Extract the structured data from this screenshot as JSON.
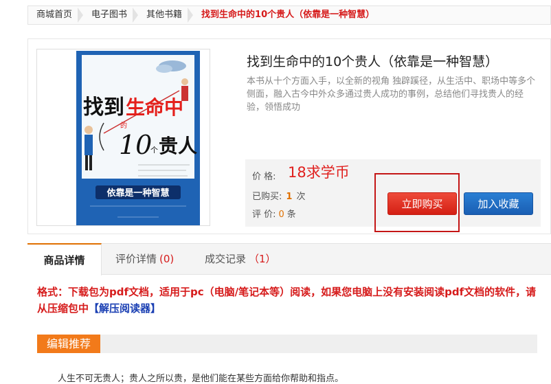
{
  "breadcrumb": {
    "items": [
      "商城首页",
      "电子图书",
      "其他书籍"
    ],
    "current": "找到生命中的10个贵人（依靠是一种智慧）"
  },
  "product": {
    "title": "找到生命中的10个贵人（依靠是一种智慧）",
    "description": "本书从十个方面入手，以全新的视角 独辟蹊径，从生活中、职场中等多个侧面，融入古今中外众多通过贵人成功的事例，总结他们寻找贵人的经验，领悟成功",
    "cover": {
      "title_top": "找到",
      "title_highlight": "生命中",
      "title_small": "的",
      "title_number": "10",
      "title_small2": "个",
      "title_end": "贵人",
      "subtitle_band": "依靠是一种智慧",
      "colors": {
        "background": "#1f63b4",
        "highlight": "#e4201c",
        "text": "#111111"
      }
    },
    "price_label": "价 格:",
    "price": "18求学币",
    "sold_label": "已购买:",
    "sold_count": "1",
    "sold_unit": "次",
    "rating_label": "评 价:",
    "rating_count": "0",
    "rating_unit": "条",
    "buy_button": "立即购买",
    "favorite_button": "加入收藏"
  },
  "tabs": [
    {
      "label": "商品详情",
      "count": ""
    },
    {
      "label": "评价详情",
      "count": "(0)"
    },
    {
      "label": "成交记录",
      "count": "（1）"
    }
  ],
  "notice": {
    "text": "格式：下载包为pdf文档，适用于pc（电脑/笔记本等）阅读，如果您电脑上没有安装阅读pdf文档的软件，请从压缩包中",
    "link": "【解压阅读器】"
  },
  "section": {
    "title": "编辑推荐"
  },
  "intro": "人生不可无贵人；贵人之所以贵，是他们能在某些方面给你帮助和指点。",
  "colors": {
    "accent": "#e07000",
    "price": "#e0201e",
    "buy": "#d41f14",
    "favorite": "#1a5eb3",
    "section": "#f27a1a"
  }
}
